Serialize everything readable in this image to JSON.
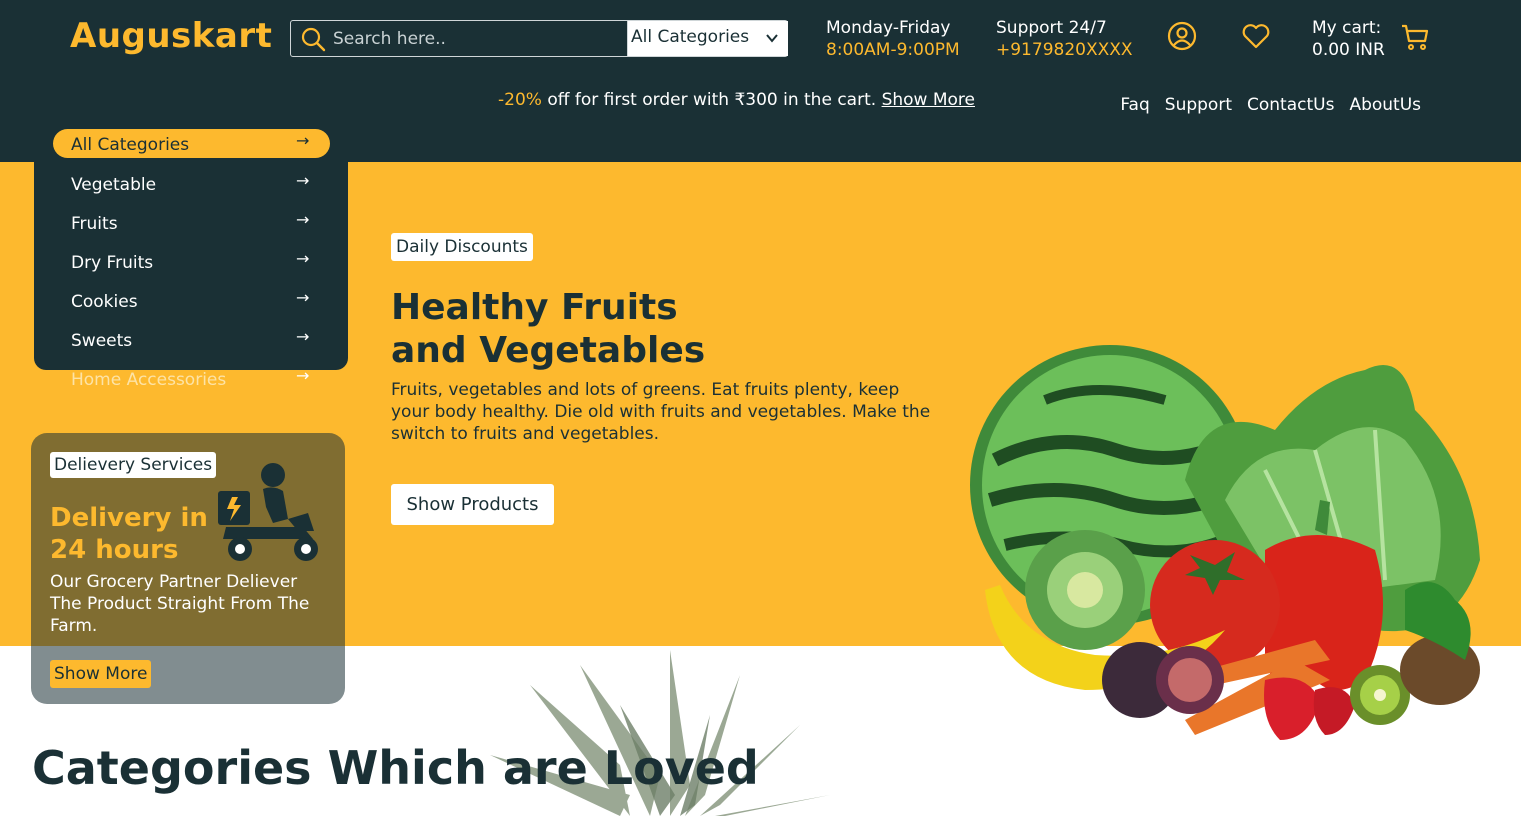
{
  "header": {
    "logo": "Auguskart",
    "search": {
      "placeholder": "Search here..",
      "category": "All Categories"
    },
    "hours": {
      "label": "Monday-Friday",
      "value": "8:00AM-9:00PM"
    },
    "support": {
      "label": "Support 24/7",
      "value": "+9179820XXXX"
    },
    "cart": {
      "label": "My cart:",
      "value": "0.00 INR"
    },
    "icons": [
      "search-icon",
      "user-icon",
      "heart-icon",
      "cart-icon",
      "chevron-down-icon"
    ]
  },
  "promo": {
    "discount": "-20%",
    "text": " off for first order with ₹300 in the cart. ",
    "link": "Show More"
  },
  "nav": [
    "Faq",
    "Support",
    "ContactUs",
    "AboutUs"
  ],
  "categories": {
    "items": [
      "All Categories",
      "Vegetable",
      "Fruits",
      "Dry Fruits",
      "Cookies",
      "Sweets",
      "Home Accessories"
    ],
    "arrow": "→"
  },
  "delivery": {
    "tag": "Delievery Services",
    "title": "Delivery in 24 hours",
    "text": "Our Grocery Partner Deliever The Product Straight From The Farm.",
    "button": "Show More"
  },
  "hero": {
    "badge": "Daily Discounts",
    "title_line1": "Healthy Fruits",
    "title_line2": "and Vegetables",
    "description": "Fruits, vegetables and lots of greens. Eat fruits plenty, keep your body healthy. Die old with fruits and vegetables. Make the switch to fruits and vegetables.",
    "button": "Show Products"
  },
  "section": {
    "title": "Categories Which are Loved"
  },
  "colors": {
    "dark": "#1a3035",
    "accent": "#fdb92e"
  }
}
